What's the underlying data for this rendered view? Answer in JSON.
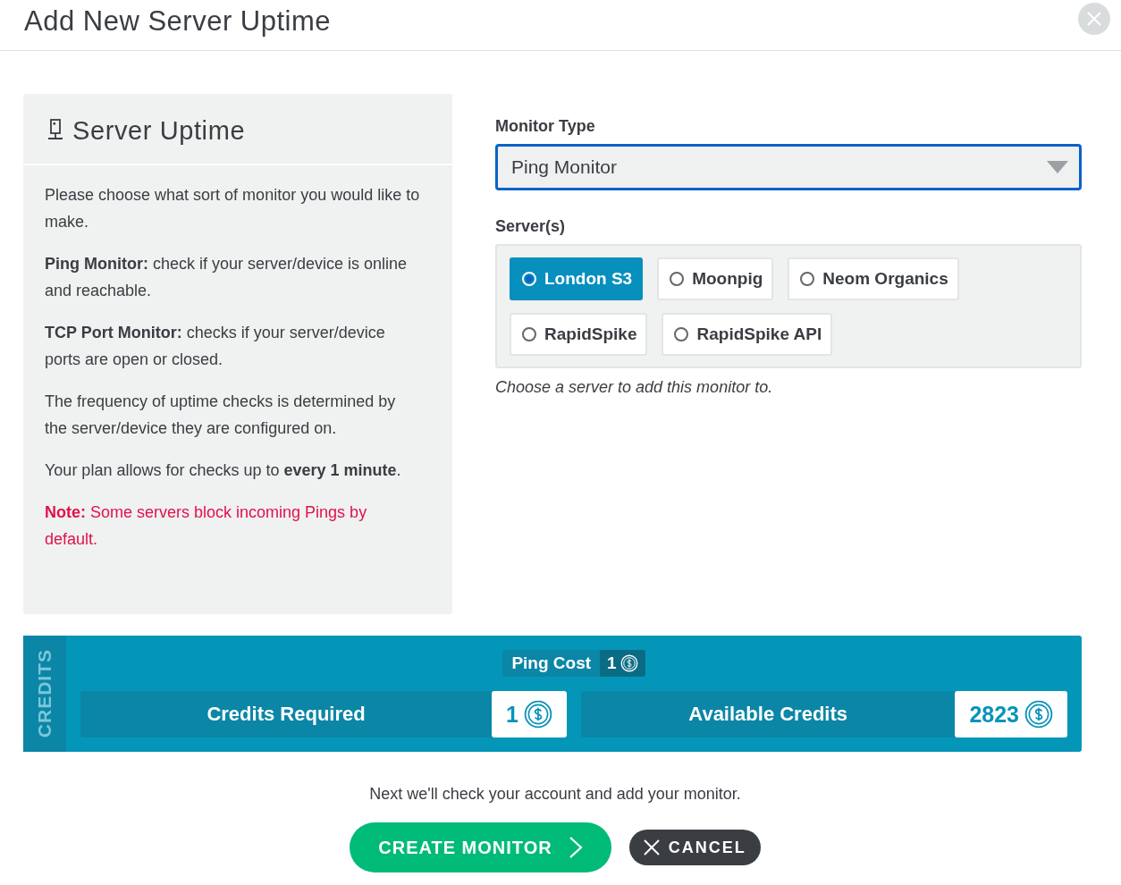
{
  "dialog": {
    "title": "Add New Server Uptime"
  },
  "info_panel": {
    "title": "Server Uptime",
    "paragraphs": [
      {
        "kind": "plain",
        "text": "Please choose what sort of monitor you would like to make."
      },
      {
        "kind": "plain",
        "text": "**Ping Monitor:** check if your server/device is online and reachable."
      },
      {
        "kind": "plain",
        "text": "**TCP Port Monitor:** checks if your server/device ports are open or closed."
      },
      {
        "kind": "plain",
        "text": "The frequency of uptime checks is determined by the server/device they are configured on."
      },
      {
        "kind": "plain",
        "text": "Your plan allows for checks up to **every 1 minute**."
      },
      {
        "kind": "note",
        "text": "**Note:** Some servers block incoming Pings by default."
      }
    ]
  },
  "monitor_type": {
    "label": "Monitor Type",
    "value": "Ping Monitor"
  },
  "servers": {
    "label": "Server(s)",
    "options": [
      {
        "label": "London S3",
        "selected": true
      },
      {
        "label": "Moonpig",
        "selected": false
      },
      {
        "label": "Neom Organics",
        "selected": false
      },
      {
        "label": "RapidSpike",
        "selected": false
      },
      {
        "label": "RapidSpike API",
        "selected": false
      }
    ],
    "help": "Choose a server to add this monitor to."
  },
  "credits": {
    "side_label": "CREDITS",
    "cost_label": "Ping Cost",
    "cost_value": "1",
    "required_label": "Credits Required",
    "required_value": "1",
    "available_label": "Available Credits",
    "available_value": "2823"
  },
  "footer": {
    "message": "Next we'll check your account and add your monitor.",
    "primary_button": "CREATE MONITOR",
    "cancel_button": "CANCEL"
  }
}
